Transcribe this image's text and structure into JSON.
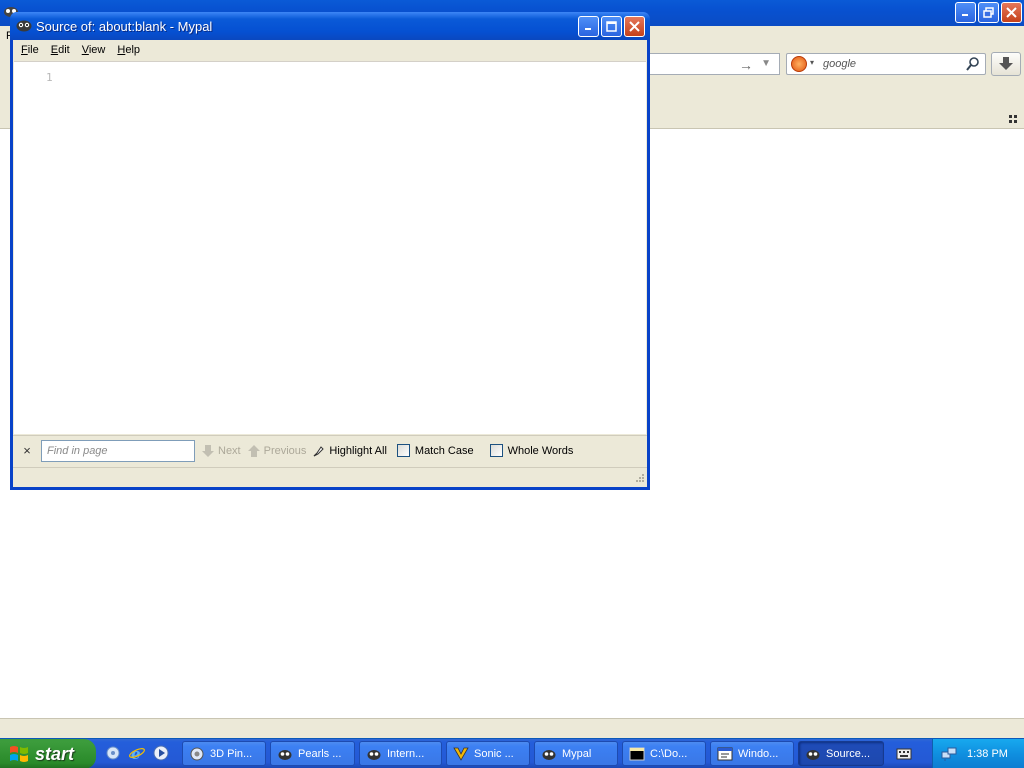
{
  "popup": {
    "title": "Source of: about:blank - Mypal",
    "menu": [
      {
        "label": "File",
        "key": "F",
        "rest": "ile"
      },
      {
        "label": "Edit",
        "key": "E",
        "rest": "dit"
      },
      {
        "label": "View",
        "key": "V",
        "rest": "iew"
      },
      {
        "label": "Help",
        "key": "H",
        "rest": "elp"
      }
    ],
    "line_number": "1",
    "findbar": {
      "close": "×",
      "placeholder": "Find in page",
      "next": "Next",
      "previous": "Previous",
      "highlight_all": "Highlight All",
      "match_case": "Match Case",
      "whole_words": "Whole Words"
    }
  },
  "browser": {
    "menu_stub": "F",
    "search_placeholder": "google"
  },
  "taskbar": {
    "start_label": "start",
    "tasks": [
      {
        "label": "3D Pin...",
        "icon": "pinball-icon",
        "active": false
      },
      {
        "label": "Pearls ...",
        "icon": "mypal-icon",
        "active": false
      },
      {
        "label": "Intern...",
        "icon": "mypal-icon",
        "active": false
      },
      {
        "label": "Sonic ...",
        "icon": "sonic-icon",
        "active": false
      },
      {
        "label": "Mypal",
        "icon": "mypal-icon",
        "active": false
      },
      {
        "label": "C:\\Do...",
        "icon": "cmd-icon",
        "active": false
      },
      {
        "label": "Windo...",
        "icon": "window-icon",
        "active": false
      },
      {
        "label": "Source...",
        "icon": "mypal-icon",
        "active": true
      }
    ],
    "clock": "1:38 PM"
  },
  "colors": {
    "xp_blue": "#0a5ad6",
    "xp_green": "#3c9c3c",
    "window_face": "#ece9d8"
  }
}
